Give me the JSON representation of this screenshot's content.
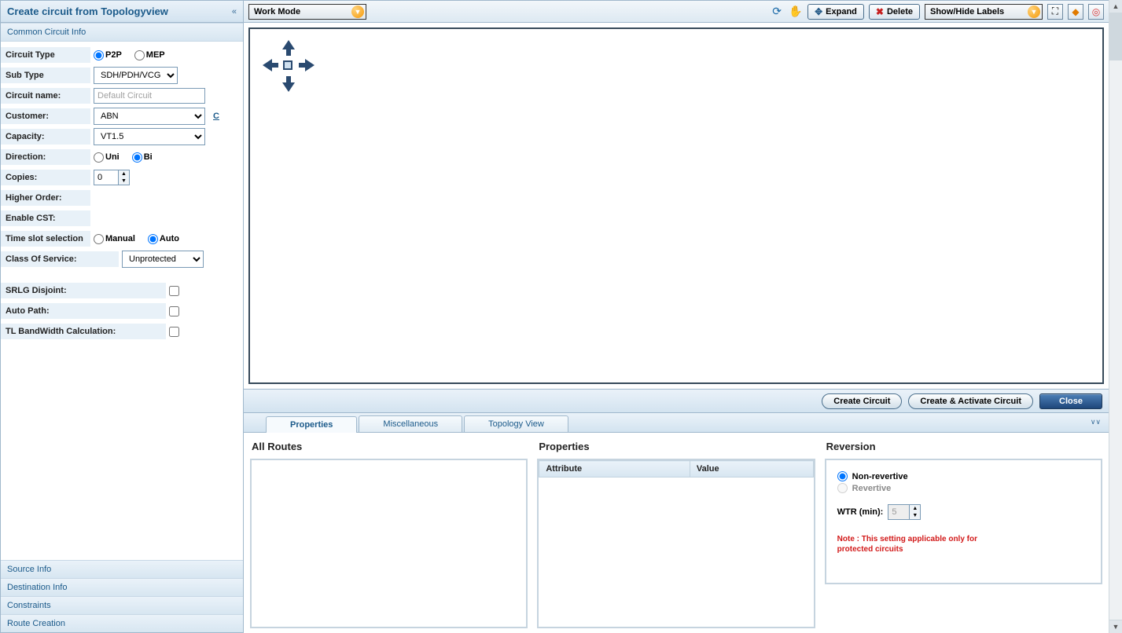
{
  "sidebar": {
    "title": "Create circuit from Topologyview",
    "sections": {
      "common": "Common Circuit Info",
      "source": "Source Info",
      "destination": "Destination Info",
      "constraints": "Constraints",
      "route": "Route Creation"
    },
    "labels": {
      "circuit_type": "Circuit Type",
      "sub_type": "Sub Type",
      "circuit_name": "Circuit name:",
      "customer": "Customer:",
      "capacity": "Capacity:",
      "direction": "Direction:",
      "copies": "Copies:",
      "higher_order": "Higher Order:",
      "enable_cst": "Enable CST:",
      "time_slot": "Time slot selection",
      "cos": "Class Of Service:",
      "srlg": "SRLG Disjoint:",
      "auto_path": "Auto Path:",
      "tl_bw": "TL BandWidth Calculation:"
    },
    "values": {
      "circuit_type_p2p": "P2P",
      "circuit_type_mep": "MEP",
      "sub_type": "SDH/PDH/VCG",
      "circuit_name_placeholder": "Default Circuit",
      "customer": "ABN",
      "customer_link": "C",
      "capacity": "VT1.5",
      "direction_uni": "Uni",
      "direction_bi": "Bi",
      "copies": "0",
      "time_slot_manual": "Manual",
      "time_slot_auto": "Auto",
      "cos": "Unprotected"
    }
  },
  "toolbar": {
    "work_mode": "Work Mode",
    "show_hide_labels": "Show/Hide Labels",
    "expand": "Expand",
    "delete": "Delete"
  },
  "actionbar": {
    "create": "Create Circuit",
    "create_activate": "Create & Activate Circuit",
    "close": "Close"
  },
  "tabs": {
    "properties": "Properties",
    "misc": "Miscellaneous",
    "topology": "Topology View"
  },
  "bottom": {
    "all_routes": "All Routes",
    "properties": "Properties",
    "reversion": "Reversion",
    "col_attribute": "Attribute",
    "col_value": "Value",
    "non_revertive": "Non-revertive",
    "revertive": "Revertive",
    "wtr_label": "WTR (min):",
    "wtr_value": "5",
    "note": "Note : This setting applicable only for protected circuits"
  }
}
